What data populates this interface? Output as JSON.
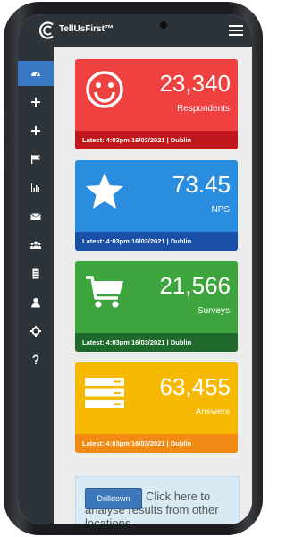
{
  "app": {
    "brand": "TellUsFirst™"
  },
  "colors": {
    "red": "#f04141",
    "blue": "#2a8de0",
    "green": "#3ea53e",
    "yellow": "#f6b800",
    "sidebar": "#2d3439",
    "active": "#3a78c3"
  },
  "sidebar": {
    "items": [
      {
        "icon": "dashboard-icon",
        "active": true
      },
      {
        "icon": "plus-icon",
        "active": false
      },
      {
        "icon": "plus-icon",
        "active": false
      },
      {
        "icon": "flag-icon",
        "active": false
      },
      {
        "icon": "bar-chart-icon",
        "active": false
      },
      {
        "icon": "envelope-icon",
        "active": false
      },
      {
        "icon": "users-icon",
        "active": false
      },
      {
        "icon": "document-icon",
        "active": false
      },
      {
        "icon": "user-icon",
        "active": false
      },
      {
        "icon": "gear-icon",
        "active": false
      },
      {
        "icon": "question-icon",
        "active": false
      }
    ]
  },
  "cards": [
    {
      "icon": "smiley-icon",
      "value": "23,340",
      "label": "Respondents",
      "latest": "Latest: 4:03pm 16/03/2021 | Dublin"
    },
    {
      "icon": "star-icon",
      "value": "73.45",
      "label": "NPS",
      "latest": "Latest: 4:03pm 16/03/2021 | Dublin"
    },
    {
      "icon": "cart-icon",
      "value": "21,566",
      "label": "Surveys",
      "latest": "Latest: 4:03pm 16/03/2021 | Dublin"
    },
    {
      "icon": "server-icon",
      "value": "63,455",
      "label": "Answers",
      "latest": "Latest: 4:03pm 16/03/2021 | Dublin"
    }
  ],
  "drilldown": {
    "button": "Drilldown",
    "text": "Click here to analyse results from other locations"
  }
}
